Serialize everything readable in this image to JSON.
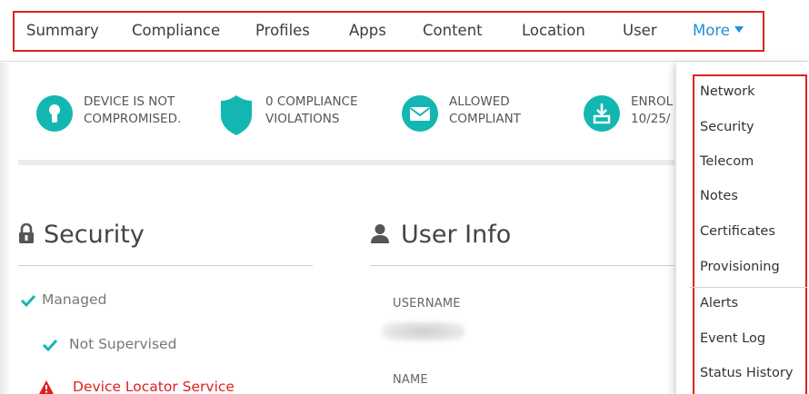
{
  "tabs": [
    "Summary",
    "Compliance",
    "Profiles",
    "Apps",
    "Content",
    "Location",
    "User"
  ],
  "more_tab": {
    "label": "More",
    "color": "#1f8fd6"
  },
  "status": [
    {
      "icon": "lock-keyhole-icon",
      "line1": "DEVICE IS NOT",
      "line2": "COMPROMISED."
    },
    {
      "icon": "shield-icon",
      "line1": "0 COMPLIANCE",
      "line2": "VIOLATIONS"
    },
    {
      "icon": "envelope-icon",
      "line1": "ALLOWED",
      "line2": "COMPLIANT"
    },
    {
      "icon": "enrollment-download-icon",
      "line1": "ENROL",
      "line2": "10/25/"
    }
  ],
  "security": {
    "title": "Security",
    "items": [
      "Managed",
      "Not Supervised"
    ],
    "alert": "Device Locator Service"
  },
  "user_info": {
    "title": "User Info",
    "username_label": "USERNAME",
    "name_label": "NAME"
  },
  "more_menu": {
    "group1": [
      "Network",
      "Security",
      "Telecom",
      "Notes",
      "Certificates",
      "Provisioning"
    ],
    "group2": [
      "Alerts",
      "Event Log",
      "Status History"
    ]
  },
  "colors": {
    "accent": "#13b7b1",
    "alert": "#e02020",
    "link": "#1f8fd6"
  }
}
